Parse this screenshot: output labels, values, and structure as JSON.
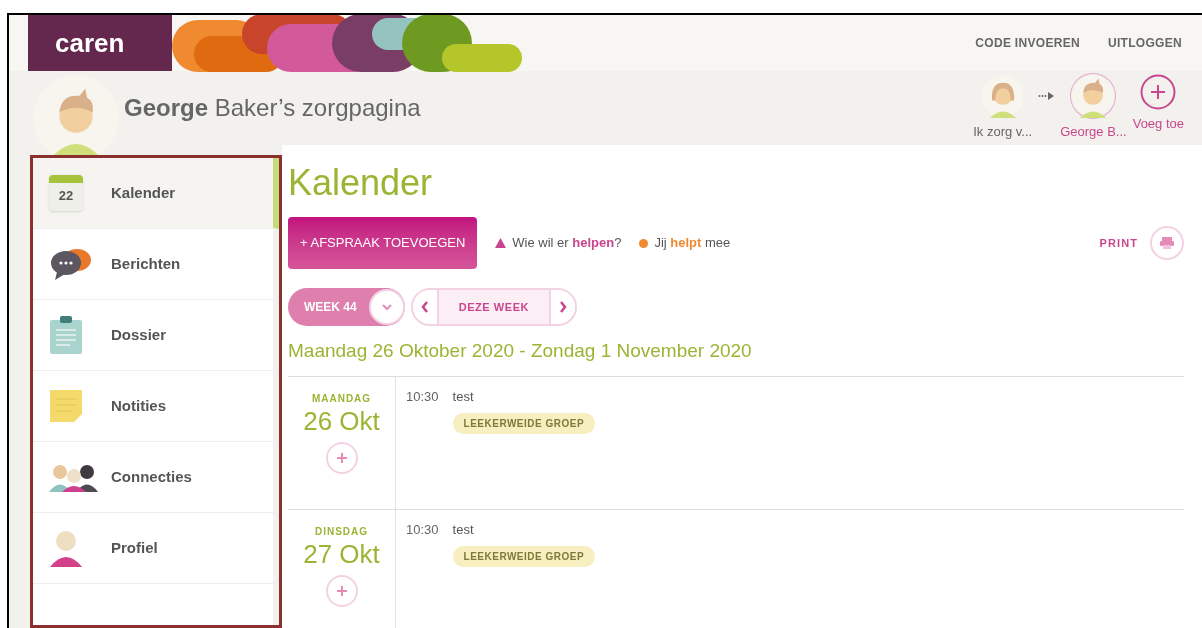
{
  "header": {
    "logo": "caren",
    "links": [
      "CODE INVOEREN",
      "UITLOGGEN"
    ]
  },
  "profile": {
    "title": "**George** Baker’s zorgpagina"
  },
  "switcher": [
    {
      "kind": "person",
      "label": "Ik zorg v...",
      "selected": false
    },
    {
      "kind": "person",
      "label": "George B...",
      "selected": true
    },
    {
      "kind": "add",
      "label": "Voeg toe",
      "selected": false
    }
  ],
  "sidebar": {
    "items": [
      {
        "kind": "calendar",
        "label": "Kalender",
        "icon_text": "22",
        "selected": true
      },
      {
        "kind": "chat",
        "label": "Berichten",
        "selected": false
      },
      {
        "kind": "clipboard",
        "label": "Dossier",
        "selected": false
      },
      {
        "kind": "note",
        "label": "Notities",
        "selected": false
      },
      {
        "kind": "people",
        "label": "Connecties",
        "selected": false
      },
      {
        "kind": "person",
        "label": "Profiel",
        "selected": false
      }
    ]
  },
  "main": {
    "title": "Kalender",
    "add_button": "+ AFSPRAAK TOEVOEGEN",
    "legend": [
      {
        "kind": "triangle",
        "text": "Wie wil er **helpen**?",
        "color": "#c9468e"
      },
      {
        "kind": "dot",
        "text": "Jij **helpt** mee",
        "color": "#f08a30"
      }
    ],
    "print": "PRINT",
    "week": "WEEK 44",
    "this_week": "DEZE WEEK",
    "range": "Maandag 26 Oktober 2020 - Zondag 1 November 2020",
    "days": [
      {
        "weekday": "MAANDAG",
        "date": "26 Okt",
        "events": [
          {
            "time": "10:30",
            "title": "test",
            "tag": "LEEKERWEIDE GROEP"
          }
        ]
      },
      {
        "weekday": "DINSDAG",
        "date": "27 Okt",
        "events": [
          {
            "time": "10:30",
            "title": "test",
            "tag": "LEEKERWEIDE GROEP"
          }
        ]
      }
    ]
  }
}
